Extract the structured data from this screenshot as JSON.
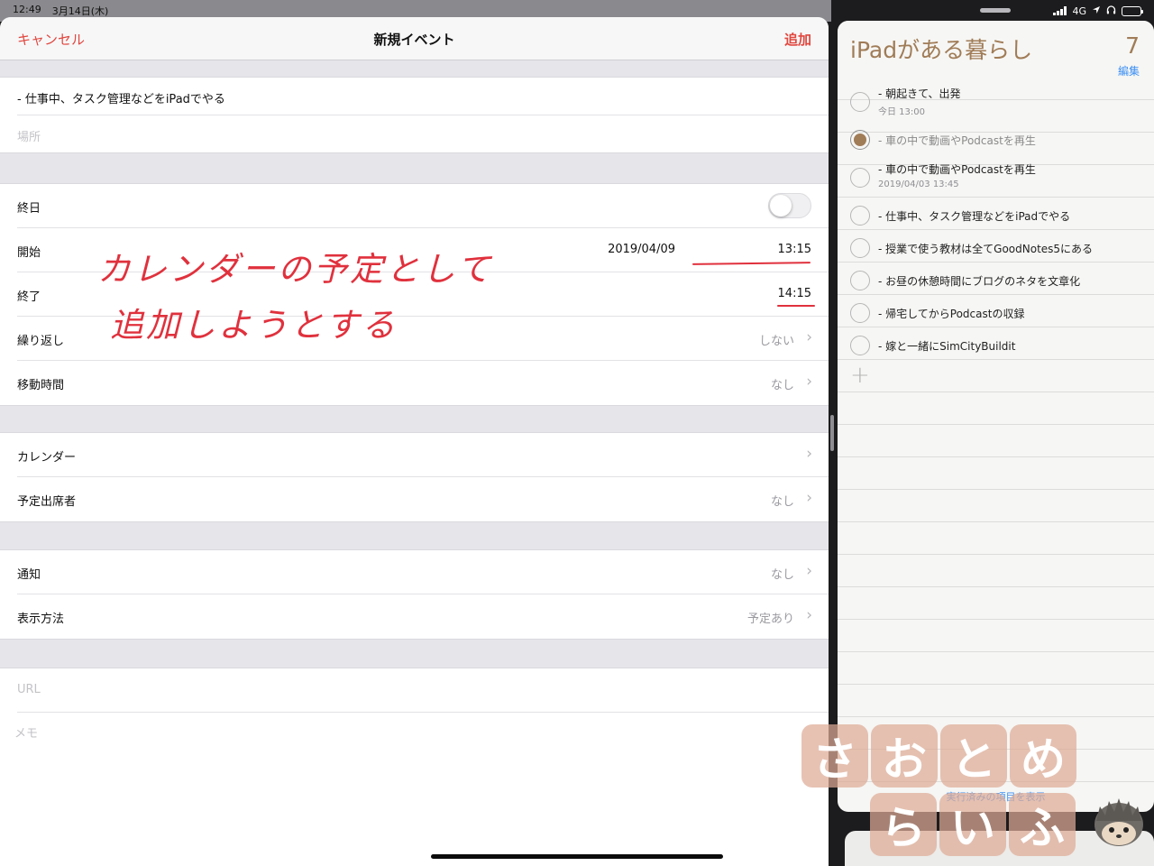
{
  "status_bar": {
    "time": "12:49",
    "date": "3月14日(木)",
    "network": "4G"
  },
  "event_editor": {
    "nav": {
      "cancel_label": "キャンセル",
      "title": "新規イベント",
      "add_label": "追加"
    },
    "title_value": "- 仕事中、タスク管理などをiPadでやる",
    "location_placeholder": "場所",
    "all_day_label": "終日",
    "all_day_on": false,
    "start_label": "開始",
    "start_date": "2019/04/09",
    "start_time": "13:15",
    "end_label": "終了",
    "end_time": "14:15",
    "repeat_label": "繰り返し",
    "repeat_value": "しない",
    "travel_label": "移動時間",
    "travel_value": "なし",
    "calendar_label": "カレンダー",
    "invitees_label": "予定出席者",
    "invitees_value": "なし",
    "alert_label": "通知",
    "alert_value": "なし",
    "show_as_label": "表示方法",
    "show_as_value": "予定あり",
    "url_placeholder": "URL",
    "notes_placeholder": "メモ"
  },
  "annotation": {
    "line1": "カレンダーの予定として",
    "line2": "追加しようとする",
    "color": "#e0313d"
  },
  "reminders": {
    "list_title": "iPadがある暮らし",
    "count": "7",
    "edit_label": "編集",
    "items": [
      {
        "text": "- 朝起きて、出発",
        "sub": "今日 13:00",
        "done": false
      },
      {
        "text": "- 車の中で動画やPodcastを再生",
        "sub": "",
        "done": true
      },
      {
        "text": "- 車の中で動画やPodcastを再生",
        "sub": "2019/04/03 13:45",
        "done": false
      },
      {
        "text": "- 仕事中、タスク管理などをiPadでやる",
        "sub": "",
        "done": false
      },
      {
        "text": "- 授業で使う教材は全てGoodNotes5にある",
        "sub": "",
        "done": false
      },
      {
        "text": "- お昼の休憩時間にブログのネタを文章化",
        "sub": "",
        "done": false
      },
      {
        "text": "- 帰宅してからPodcastの収録",
        "sub": "",
        "done": false
      },
      {
        "text": "- 嫁と一緒にSimCityBuildit",
        "sub": "",
        "done": false
      }
    ],
    "add_symbol": "+",
    "show_completed_label": "実行済みの項目を表示",
    "accent_color": "#a07c57"
  },
  "watermark": {
    "row1": [
      "さ",
      "お",
      "と",
      "め"
    ],
    "row2": [
      "ら",
      "い",
      "ふ"
    ]
  },
  "icons": {
    "chevron": "chevron-right-icon",
    "add": "plus-icon",
    "headphones": "headphones-icon",
    "location": "location-arrow-icon"
  }
}
